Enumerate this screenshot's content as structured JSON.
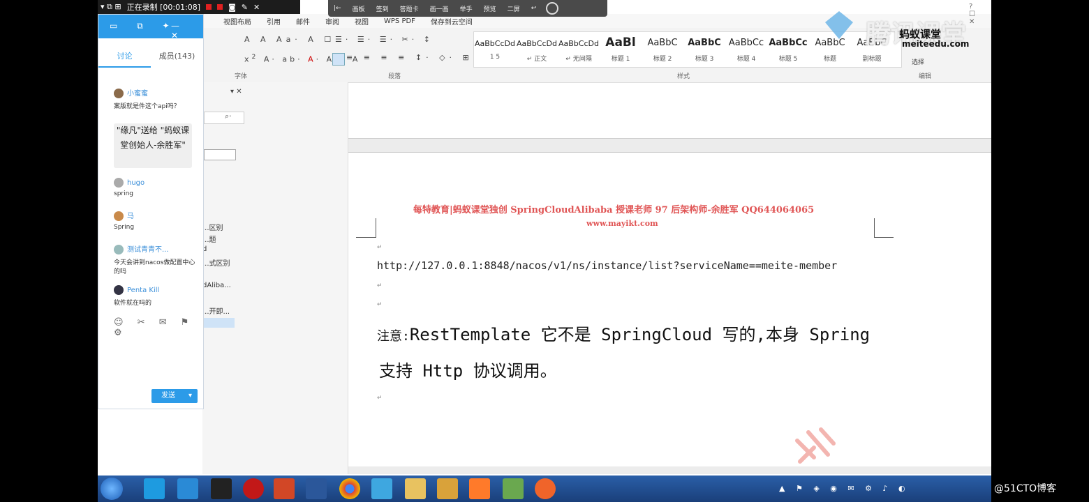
{
  "recording": {
    "status": "正在录制 [00:01:08]"
  },
  "overlay_toolbar": {
    "items": [
      "画板",
      "签到",
      "答题卡",
      "画一画",
      "举手",
      "预览",
      "二屏"
    ]
  },
  "ribbon": {
    "tabs": [
      "视图布局",
      "引用",
      "邮件",
      "审阅",
      "视图",
      "WPS PDF",
      "保存到云空间"
    ],
    "groups": {
      "font": "字体",
      "paragraph": "段落",
      "styles": "样式",
      "edit": "编辑"
    },
    "styles": [
      {
        "preview": "AaBbCcDd",
        "label": "1 5"
      },
      {
        "preview": "AaBbCcDd",
        "label": "↵ 正文"
      },
      {
        "preview": "AaBbCcDd",
        "label": "↵ 无间隔"
      },
      {
        "preview": "AaBl",
        "label": "标题 1"
      },
      {
        "preview": "AaBbC",
        "label": "标题 2"
      },
      {
        "preview": "AaBbC",
        "label": "标题 3"
      },
      {
        "preview": "AaBbCc",
        "label": "标题 4"
      },
      {
        "preview": "AaBbCc",
        "label": "标题 5"
      },
      {
        "preview": "AaBbC",
        "label": "标题"
      },
      {
        "preview": "AaBbC",
        "label": "副标题"
      }
    ],
    "select_label": "选择"
  },
  "watermark": {
    "title": "腾讯课堂",
    "brand": "蚂蚁课堂",
    "site": "meiteedu.com"
  },
  "nav_pane": {
    "items": [
      "...区别",
      "...题",
      "d",
      "...式区别",
      "dAliba...",
      "...开即..."
    ]
  },
  "document": {
    "header_line": "每特教育|蚂蚁课堂独创 SpringCloudAlibaba 授课老师 97 后架构师-余胜军 QQ644064065",
    "header_site": "www.mayikt.com",
    "url_line": "http://127.0.0.1:8848/nacos/v1/ns/instance/list?serviceName==meite-member",
    "note_label": "注意:",
    "note_line1": "RestTemplate 它不是 SpringCloud 写的,本身 Spring",
    "note_line2": "支持 Http 协议调用。"
  },
  "chat": {
    "tab_discuss": "讨论",
    "tab_members": "成员(143)",
    "messages": [
      {
        "name": "小蜜蜜",
        "text": "案版就是件这个api吗？"
      },
      {
        "name": "hugo",
        "text": "spring"
      },
      {
        "name": "马",
        "text": "Spring"
      },
      {
        "name": "测试青青不...",
        "text": "今天会讲到nacos做配置中心的吗"
      },
      {
        "name": "Penta Kill",
        "text": "软件就在吗的"
      }
    ],
    "gift_text": "\"缘凡\"送给 \"蚂蚁课堂创始人-余胜军\"",
    "send_label": "发送"
  },
  "external_watermark": "@51CTO博客"
}
